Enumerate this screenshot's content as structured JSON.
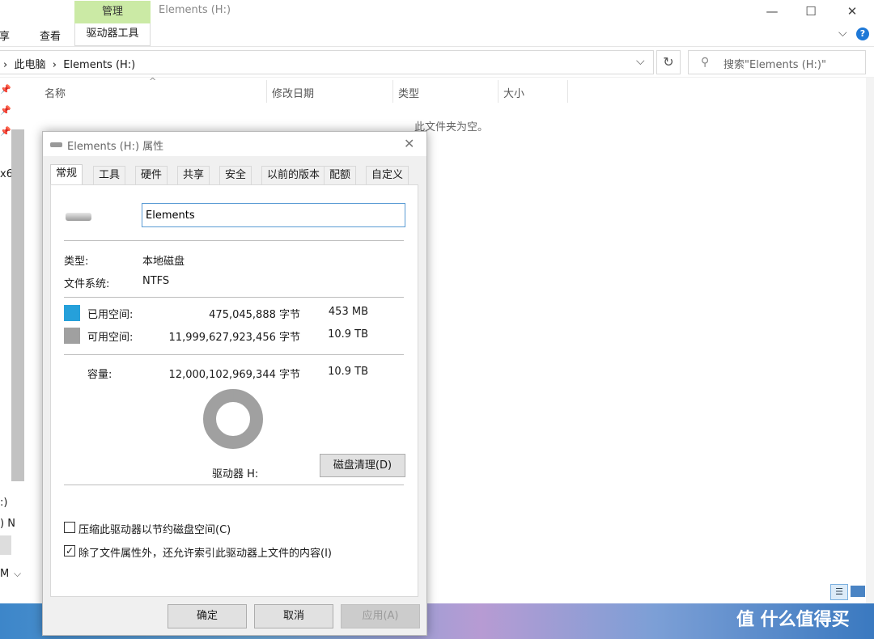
{
  "explorer": {
    "window_title": "Elements (H:)",
    "context_tab": "管理",
    "context_subtab": "驱动器工具",
    "ribbon_tabs": [
      "共享",
      "查看"
    ],
    "breadcrumb": [
      "此电脑",
      "Elements (H:)"
    ],
    "search_placeholder": "搜索\"Elements (H:)\"",
    "columns": [
      "名称",
      "修改日期",
      "类型",
      "大小"
    ],
    "empty_message": "此文件夹为空。",
    "nav_fragments": [
      "x6",
      ":)",
      ") N",
      "M"
    ]
  },
  "dialog": {
    "title": "Elements (H:) 属性",
    "tabs": [
      "常规",
      "工具",
      "硬件",
      "共享",
      "安全",
      "以前的版本",
      "配额",
      "自定义"
    ],
    "active_tab": "常规",
    "drive_name": "Elements",
    "type_label": "类型:",
    "type_value": "本地磁盘",
    "fs_label": "文件系统:",
    "fs_value": "NTFS",
    "used": {
      "label": "已用空间:",
      "bytes": "475,045,888 字节",
      "size": "453 MB",
      "color": "#26a0da"
    },
    "free": {
      "label": "可用空间:",
      "bytes": "11,999,627,923,456 字节",
      "size": "10.9 TB",
      "color": "#a0a0a0"
    },
    "capacity": {
      "label": "容量:",
      "bytes": "12,000,102,969,344 字节",
      "size": "10.9 TB"
    },
    "drive_label": "驱动器 H:",
    "cleanup_button": "磁盘清理(D)",
    "compress_option": {
      "label": "压缩此驱动器以节约磁盘空间(C)",
      "checked": false
    },
    "index_option": {
      "label": "除了文件属性外，还允许索引此驱动器上文件的内容(I)",
      "checked": true
    },
    "ok_button": "确定",
    "cancel_button": "取消",
    "apply_button": "应用(A)"
  },
  "watermark": "值 什么值得买"
}
